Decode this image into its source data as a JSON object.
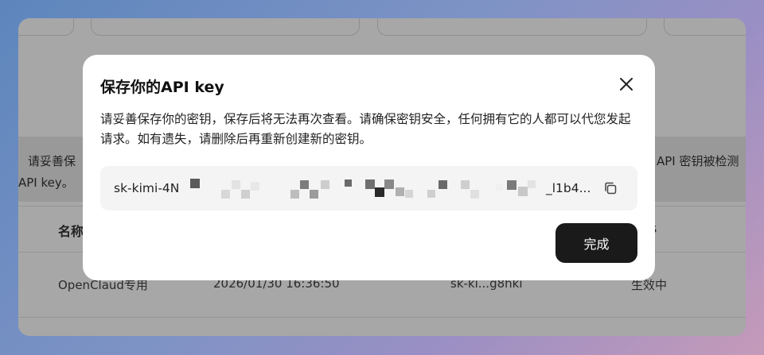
{
  "background_page": {
    "notice_line1": "请妥善保",
    "notice_line2": "API key。",
    "notice_right": "API 密钥被检测",
    "table": {
      "header_name": "名称",
      "header_status_fragment": "s",
      "row": {
        "name": "OpenClaud专用",
        "created": "2026/01/30 16:36:50",
        "key": "sk-ki...g8hki",
        "status": "生效中"
      }
    }
  },
  "dialog": {
    "title": "保存你的API key",
    "description": "请妥善保存你的密钥，保存后将无法再次查看。请确保密钥安全，任何拥有它的人都可以代您发起请求。如有遗失，请删除后再重新创建新的密钥。",
    "api_key_prefix": "sk-kimi-4N",
    "api_key_suffix": "_l1b4...",
    "done_label": "完成",
    "close_icon": "close-icon",
    "copy_icon": "copy-icon"
  },
  "colors": {
    "overlay_window": "#a7a7a7",
    "dialog_bg": "#ffffff",
    "key_box_bg": "#f4f4f5",
    "primary_button": "#1a1a1a"
  }
}
